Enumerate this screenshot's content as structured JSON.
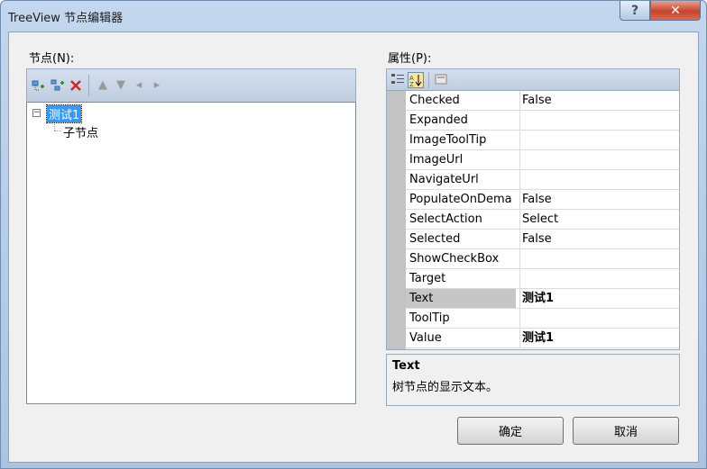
{
  "window": {
    "title": "TreeView 节点编辑器",
    "help_label": "?",
    "close_label": "✕"
  },
  "nodes_panel": {
    "label": "节点(N):",
    "root": {
      "text": "测试1",
      "expander": "−"
    },
    "child": {
      "text": "子节点"
    }
  },
  "props_panel": {
    "label": "属性(P):",
    "rows": [
      {
        "name": "Checked",
        "value": "False"
      },
      {
        "name": "Expanded",
        "value": ""
      },
      {
        "name": "ImageToolTip",
        "value": ""
      },
      {
        "name": "ImageUrl",
        "value": ""
      },
      {
        "name": "NavigateUrl",
        "value": ""
      },
      {
        "name": "PopulateOnDema",
        "value": "False"
      },
      {
        "name": "SelectAction",
        "value": "Select"
      },
      {
        "name": "Selected",
        "value": "False"
      },
      {
        "name": "ShowCheckBox",
        "value": ""
      },
      {
        "name": "Target",
        "value": ""
      },
      {
        "name": "Text",
        "value": "测试1"
      },
      {
        "name": "ToolTip",
        "value": ""
      },
      {
        "name": "Value",
        "value": "测试1"
      }
    ],
    "description_title": "Text",
    "description_text": "树节点的显示文本。"
  },
  "buttons": {
    "ok": "确定",
    "cancel": "取消"
  },
  "icons": {
    "add_root": "add-root-node-icon",
    "add_child": "add-child-node-icon",
    "delete": "delete-node-icon",
    "move_up": "move-up-icon",
    "move_down": "move-down-icon",
    "indent": "indent-icon",
    "outdent": "outdent-icon",
    "categorized": "categorized-icon",
    "alphabetical": "alphabetical-icon",
    "property_pages": "property-pages-icon"
  }
}
